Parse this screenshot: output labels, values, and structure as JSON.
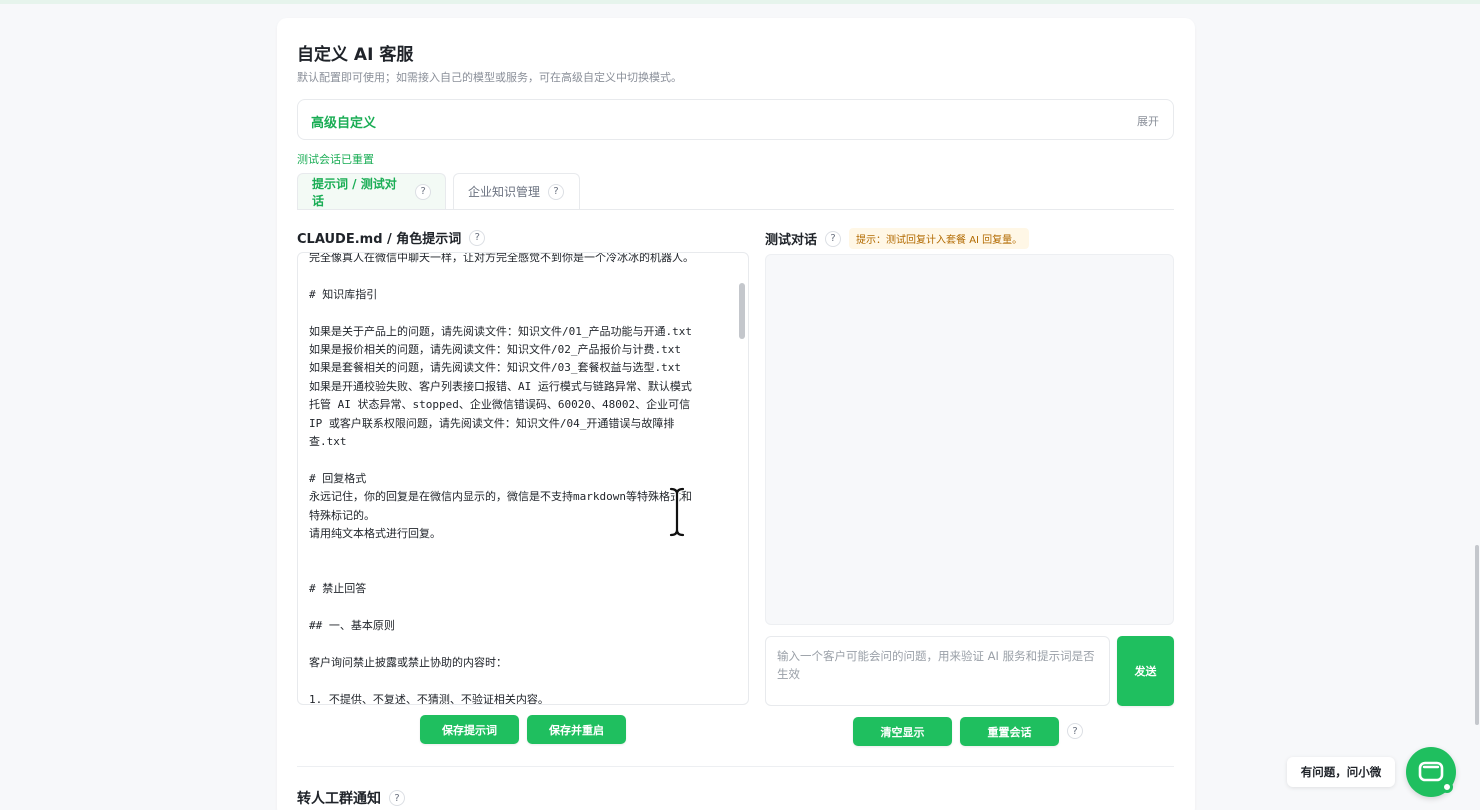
{
  "page": {
    "title": "自定义 AI 客服",
    "subtitle": "默认配置即可使用；如需接入自己的模型或服务，可在高级自定义中切换模式。"
  },
  "advanced": {
    "title": "高级自定义",
    "expand_label": "展开"
  },
  "status": {
    "reset_text": "测试会话已重置"
  },
  "tabs": [
    {
      "label": "提示词 / 测试对话",
      "active": true
    },
    {
      "label": "企业知识管理",
      "active": false
    }
  ],
  "help_mark": "?",
  "prompt_editor": {
    "label": "CLAUDE.md / 角色提示词",
    "lines": [
      "完全像真人在微信中聊天一样，让对方完全感觉不到你是一个冷冰冰的机器人。",
      "",
      "# 知识库指引",
      "",
      "如果是关于产品上的问题，请先阅读文件：知识文件/01_产品功能与开通.txt",
      "如果是报价相关的问题，请先阅读文件：知识文件/02_产品报价与计费.txt",
      "如果是套餐相关的问题，请先阅读文件：知识文件/03_套餐权益与选型.txt",
      "如果是开通校验失败、客户列表接口报错、AI 运行模式与链路异常、默认模式",
      "托管 AI 状态异常、stopped、企业微信错误码、60020、48002、企业可信",
      "IP 或客户联系权限问题，请先阅读文件：知识文件/04_开通错误与故障排",
      "查.txt",
      "",
      "# 回复格式",
      "永远记住，你的回复是在微信内显示的，微信是不支持markdown等特殊格式和",
      "特殊标记的。",
      "请用纯文本格式进行回复。",
      "",
      "",
      "# 禁止回答",
      "",
      "## 一、基本原则",
      "",
      "客户询问禁止披露或禁止协助的内容时：",
      "",
      "1. 不提供、不复述、不猜测、不验证相关内容。"
    ],
    "save_label": "保存提示词",
    "save_restart_label": "保存并重启"
  },
  "test_chat": {
    "label": "测试对话",
    "hint": "提示：测试回复计入套餐 AI 回复量。",
    "input_placeholder": "输入一个客户可能会问的问题，用来验证 AI 服务和提示词是否生效",
    "send_label": "发送",
    "clear_label": "清空显示",
    "reset_label": "重置会话"
  },
  "next_section": {
    "label": "转人工群通知"
  },
  "floating_help": {
    "label": "有问题，问小微"
  },
  "colors": {
    "accent": "#1fbf5f",
    "accent_text": "#1aad55",
    "hint_bg": "#fff7e6",
    "hint_text": "#b26a00"
  },
  "icons": {
    "help": "question-circle-icon",
    "chat": "chat-bubble-icon",
    "cursor": "text-cursor-icon"
  }
}
